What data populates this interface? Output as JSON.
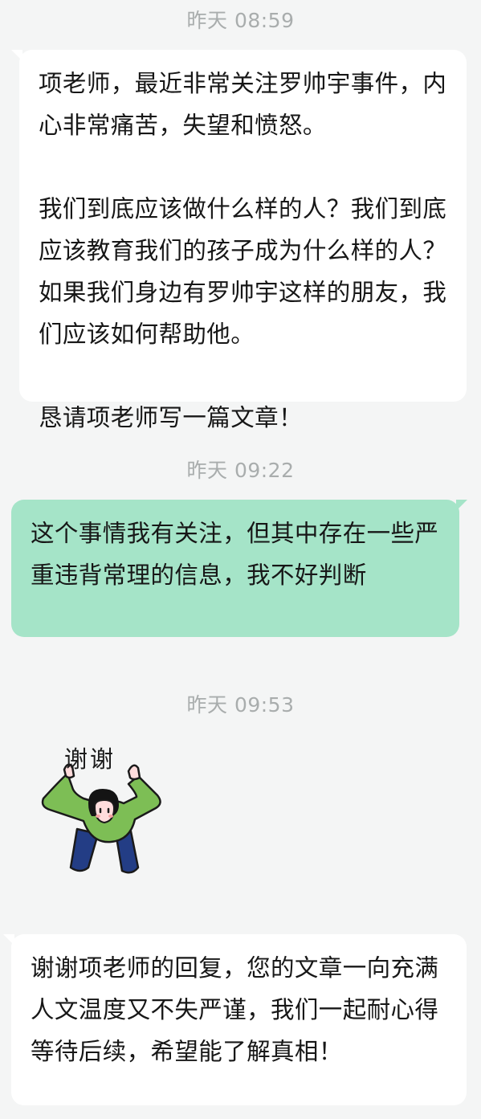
{
  "messages": [
    {
      "timestamp": "昨天 08:59",
      "direction": "incoming",
      "paragraphs": [
        "项老师，最近非常关注罗帅宇事件，内心非常痛苦，失望和愤怒。",
        "我们到底应该做什么样的人？我们到底应该教育我们的孩子成为什么样的人？如果我们身边有罗帅宇这样的朋友，我们应该如何帮助他。",
        "恳请项老师写一篇文章！"
      ]
    },
    {
      "timestamp": "昨天 09:22",
      "direction": "outgoing",
      "paragraphs": [
        "这个事情我有关注，但其中存在一些严重违背常理的信息，我不好判断"
      ]
    },
    {
      "timestamp": "昨天 09:53",
      "direction": "incoming",
      "sticker": {
        "text": "谢谢",
        "icon": "bowing-person-sticker"
      }
    },
    {
      "direction": "incoming",
      "paragraphs": [
        "谢谢项老师的回复，您的文章一向充满人文温度又不失严谨，我们一起耐心得等待后续，希望能了解真相！"
      ]
    }
  ],
  "colors": {
    "background": "#f4f5f5",
    "incoming_bubble": "#ffffff",
    "outgoing_bubble": "#a5e4c8",
    "timestamp_text": "#a9adad"
  }
}
